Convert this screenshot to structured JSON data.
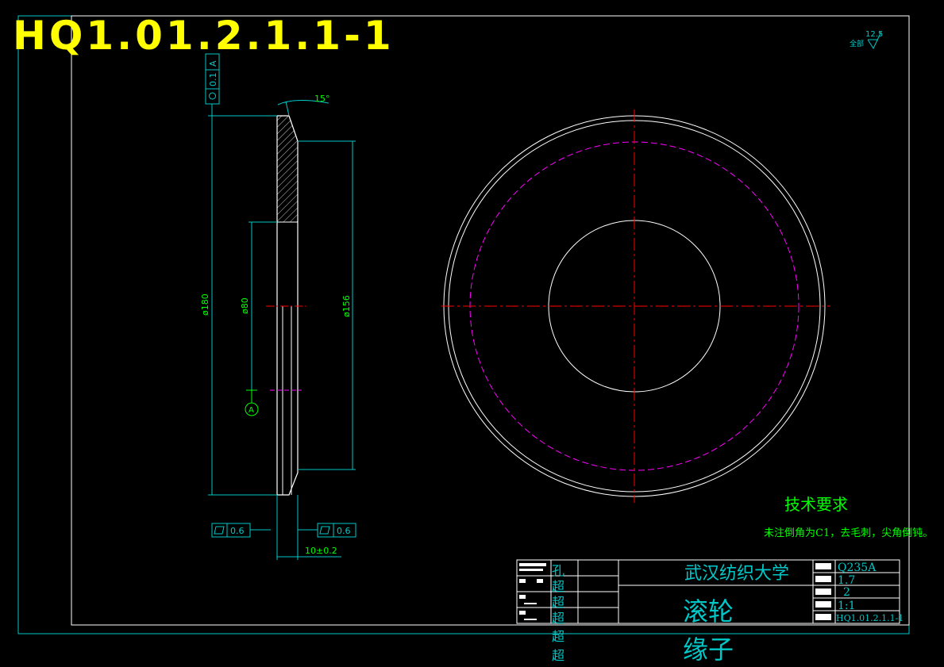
{
  "drawing_number_large": "HQ1.01.2.1.1-1",
  "surface_finish": {
    "value": "12.5",
    "note": "全部"
  },
  "dimensions": {
    "d180": "ø180",
    "d80": "ø80",
    "d156": "ø156",
    "angle": "15°",
    "thickness": "10±0.2",
    "datum": "A"
  },
  "tolerances": {
    "top": {
      "value": "0.1",
      "datum": "A"
    },
    "bottom_left": {
      "value": "0.6"
    },
    "bottom_right": {
      "value": "0.6"
    }
  },
  "technical_requirements": {
    "title": "技术要求",
    "text": "未注倒角为C1，去毛刺，尖角倒钝。"
  },
  "title_block": {
    "school": "武汉纺织大学",
    "part_name": "滚轮",
    "designer": "缘子",
    "material": "Q235A",
    "weight": "1.7",
    "quantity": "2",
    "scale": "1:1",
    "drawing_no": "HQ1.01.2.1.1-1",
    "left_col_chars": [
      "孔",
      "超",
      "超",
      "超",
      "超",
      "超"
    ]
  },
  "colors": {
    "background": "#000000",
    "white_line": "#ffffff",
    "dim_cyan": "#00c8c8",
    "dim_green": "#00ff00",
    "center_red": "#ff0000",
    "pitch_magenta": "#ff00ff",
    "title_yellow": "#ffff00"
  }
}
